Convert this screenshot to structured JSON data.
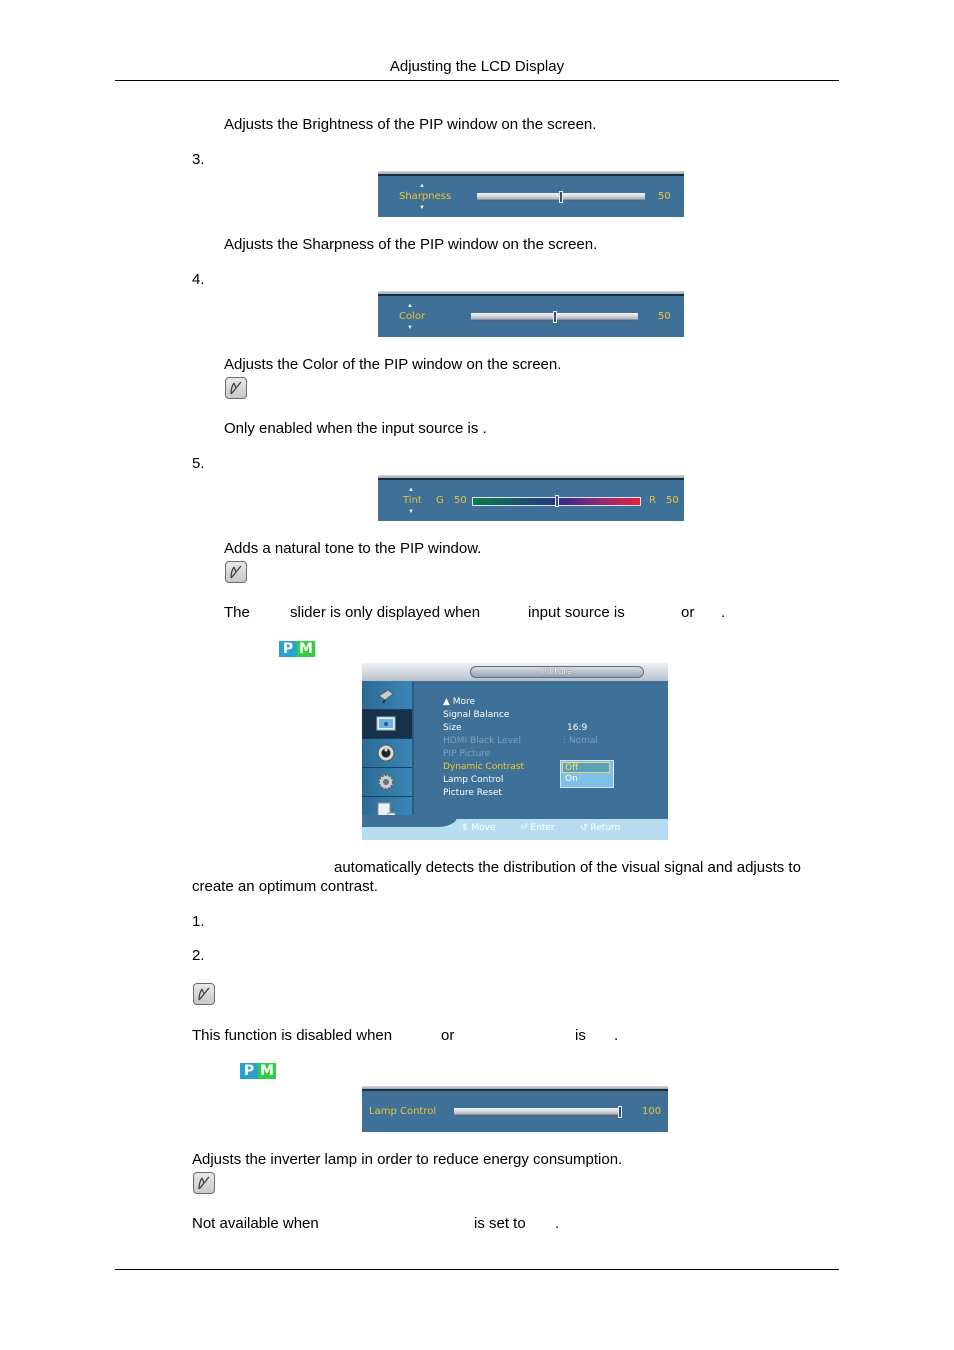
{
  "header": {
    "title": "Adjusting the LCD Display"
  },
  "sections": {
    "brightness": {
      "description": "Adjusts the Brightness of the PIP window on the screen."
    },
    "sharpness": {
      "number": "3.",
      "osd": {
        "label": "Sharpness",
        "value": "50",
        "level_percent": 50
      },
      "description": "Adjusts the Sharpness of the PIP window on the screen."
    },
    "color": {
      "number": "4.",
      "osd": {
        "label": "Color",
        "value": "50",
        "level_percent": 50
      },
      "description": "Adjusts the Color of the PIP window on the screen.",
      "note": "Only enabled when the       input source is        ."
    },
    "tint": {
      "number": "5.",
      "osd": {
        "label": "Tint",
        "left_channel": "G",
        "left_value": "50",
        "right_channel": "R",
        "right_value": "50",
        "level_percent": 50
      },
      "description": "Adds a natural tone to the PIP window.",
      "note_parts": [
        "The",
        "slider is only displayed when",
        "input source is",
        "or",
        "."
      ]
    },
    "dynamic_contrast": {
      "badge": {
        "p": "P",
        "m": "M"
      },
      "menu": {
        "title": "Picture",
        "items": [
          {
            "label": "▲ More",
            "state": "normal"
          },
          {
            "label": "Signal Balance",
            "state": "normal"
          },
          {
            "label": "Size",
            "value": "16:9",
            "state": "normal"
          },
          {
            "label": "HDMI Black Level",
            "value": ": Nomal",
            "state": "disabled"
          },
          {
            "label": "PIP Picture",
            "state": "disabled"
          },
          {
            "label": "Dynamic Contrast",
            "value": ":",
            "state": "selected"
          },
          {
            "label": "Lamp Control",
            "state": "normal"
          },
          {
            "label": "Picture Reset",
            "state": "normal"
          }
        ],
        "dropdown_options": [
          "Off",
          "On"
        ],
        "dropdown_selected": "Off",
        "footer": {
          "move": "Move",
          "enter": "Enter",
          "return": "Return"
        }
      },
      "description_line1": "automatically detects the distribution of the visual signal and adjusts to",
      "description_line2": "create an optimum contrast.",
      "list": [
        "1.",
        "2."
      ],
      "note_parts": [
        "This function is disabled when",
        "or",
        "is",
        "."
      ]
    },
    "lamp_control": {
      "badge": {
        "p": "P",
        "m": "M"
      },
      "osd": {
        "label": "Lamp Control",
        "value": "100",
        "level_percent": 100
      },
      "description": "Adjusts the inverter lamp in order to reduce energy consumption.",
      "note_parts": [
        "Not available when",
        "is set to",
        "."
      ]
    }
  }
}
